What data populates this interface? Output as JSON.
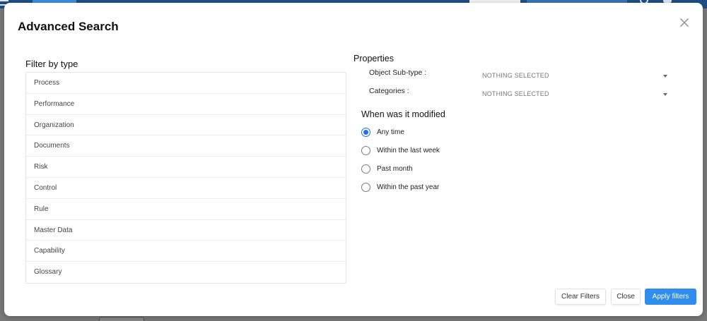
{
  "modal": {
    "title": "Advanced Search"
  },
  "filter_by_type": {
    "heading": "Filter by type",
    "items": [
      "Process",
      "Performance",
      "Organization",
      "Documents",
      "Risk",
      "Control",
      "Rule",
      "Master Data",
      "Capability",
      "Glossary"
    ]
  },
  "properties": {
    "heading": "Properties",
    "fields": [
      {
        "label": "Object Sub-type :",
        "value": "NOTHING SELECTED"
      },
      {
        "label": "Categories :",
        "value": "NOTHING SELECTED"
      }
    ]
  },
  "modified": {
    "heading": "When was it modified",
    "options": [
      {
        "label": "Any time",
        "checked": true
      },
      {
        "label": "Within the last week",
        "checked": false
      },
      {
        "label": "Past month",
        "checked": false
      },
      {
        "label": "Within the past year",
        "checked": false
      }
    ]
  },
  "footer": {
    "clear_label": "Clear Filters",
    "close_label": "Close",
    "apply_label": "Apply filters"
  },
  "colors": {
    "accent": "#2f8eed",
    "radio_checked": "#1a73e8",
    "topbar": "#1f4f82"
  },
  "icons": {
    "close": "close-icon",
    "caret": "chevron-down-icon",
    "menu": "menu-icon"
  }
}
